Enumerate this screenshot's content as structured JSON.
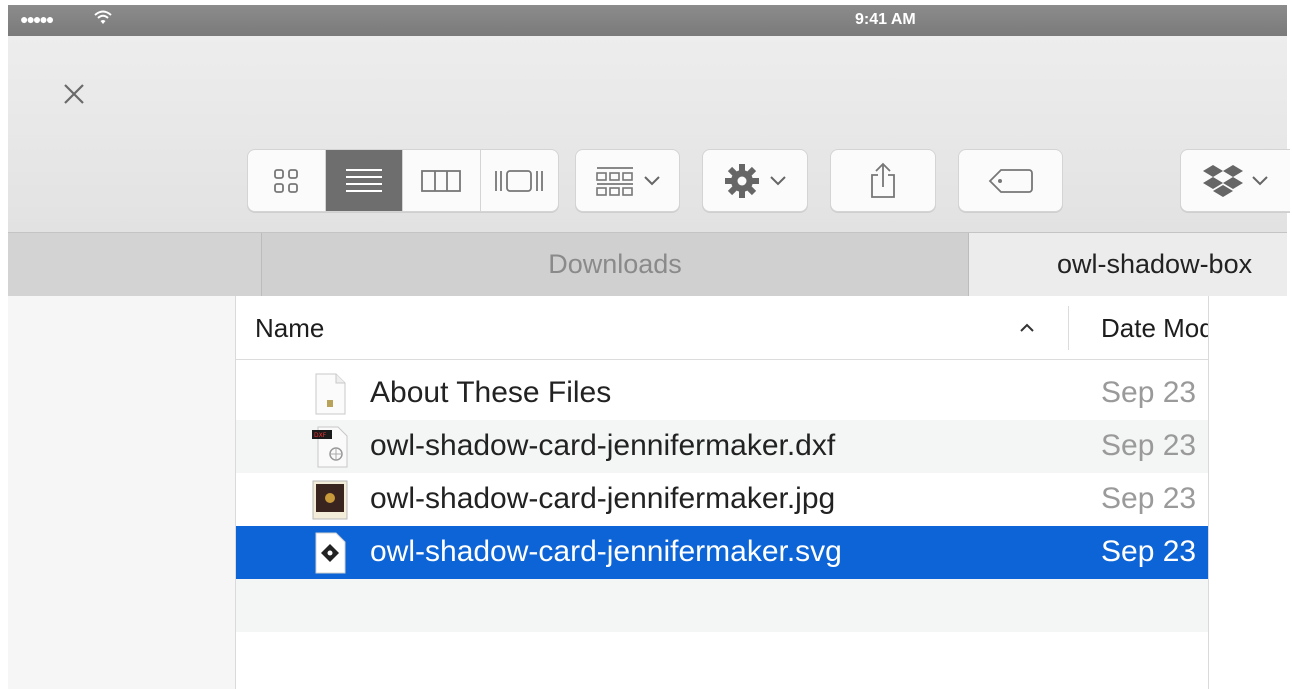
{
  "status_bar": {
    "signal": "●●●●●",
    "time": "9:41 AM"
  },
  "toolbar": {
    "close_icon": "close-icon",
    "view_modes": [
      "icon-view-icon",
      "list-view-icon",
      "column-view-icon",
      "cover-flow-icon"
    ],
    "active_view": 1,
    "buttons": [
      "group-icon",
      "gear-icon",
      "share-icon",
      "tag-icon",
      "dropbox-icon"
    ]
  },
  "path_tabs": {
    "left": "",
    "middle": "Downloads",
    "right": "owl-shadow-box"
  },
  "columns": {
    "name": "Name",
    "date": "Date Modified"
  },
  "files": [
    {
      "name": "About These Files",
      "date": "Sep 23",
      "icon": "text-file-icon"
    },
    {
      "name": "owl-shadow-card-jennifermaker.dxf",
      "date": "Sep 23",
      "icon": "dxf-file-icon"
    },
    {
      "name": "owl-shadow-card-jennifermaker.jpg",
      "date": "Sep 23",
      "icon": "jpg-file-icon"
    },
    {
      "name": "owl-shadow-card-jennifermaker.svg",
      "date": "Sep 23",
      "icon": "svg-file-icon",
      "selected": true
    }
  ],
  "colors": {
    "selection": "#0d64d6",
    "toolbar": "#e8e8e8",
    "statusbar": "#858585"
  }
}
